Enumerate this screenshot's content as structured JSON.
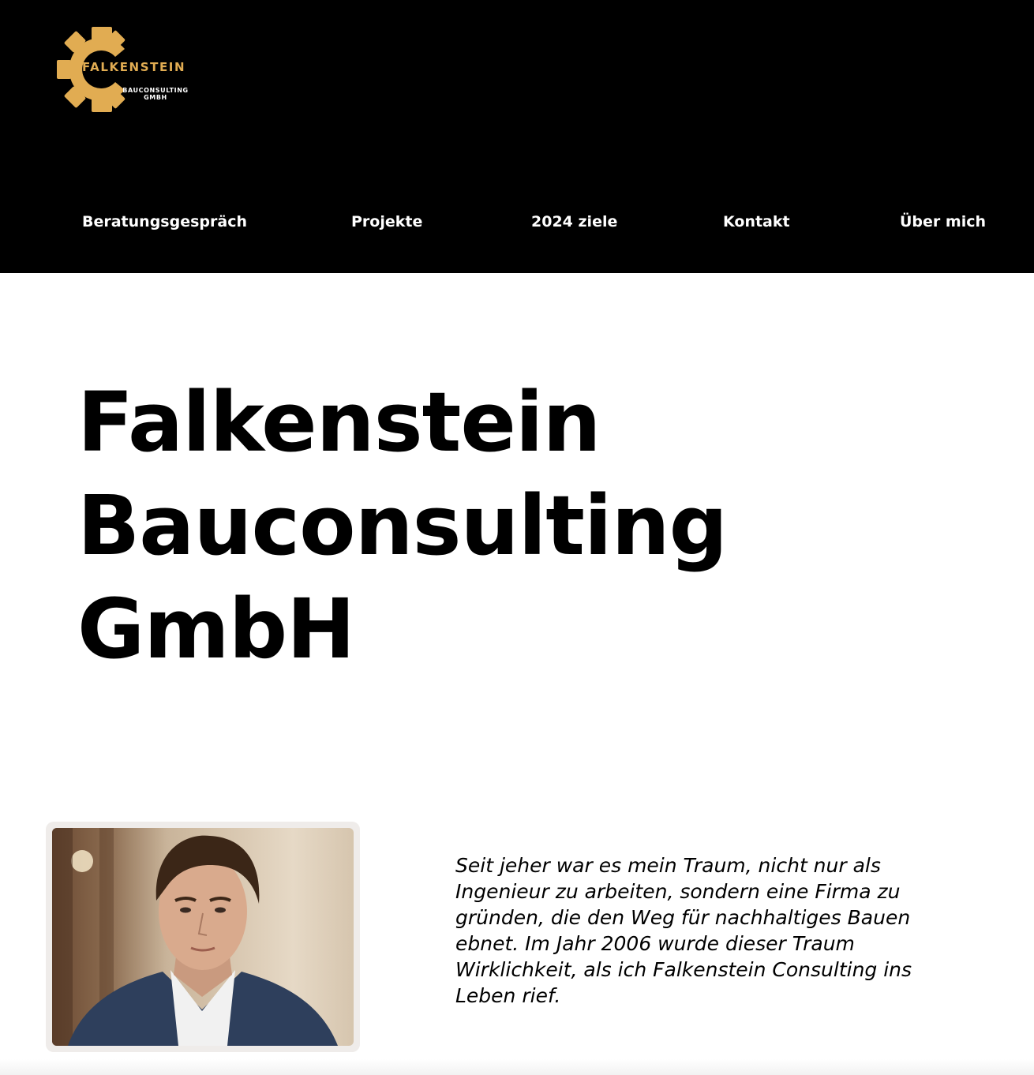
{
  "logo": {
    "word": "FALKENSTEIN",
    "subline1": "BAUCONSULTING",
    "subline2": "GMBH",
    "accent_color": "#e1ac52",
    "icon": "gear-icon"
  },
  "nav": {
    "items": [
      {
        "label": "Beratungsgespräch"
      },
      {
        "label": "Projekte"
      },
      {
        "label": "2024 ziele"
      },
      {
        "label": "Kontakt"
      },
      {
        "label": "Über mich"
      }
    ]
  },
  "hero": {
    "title_lines": [
      "Falkenstein",
      "Bauconsulting",
      "GmbH"
    ]
  },
  "about": {
    "photo_alt": "portrait-photo",
    "text": "Seit jeher war es mein Traum, nicht nur als Ingenieur zu arbeiten, sondern eine Firma zu gründen, die den Weg für nachhaltiges Bauen ebnet. Im Jahr 2006 wurde dieser Traum Wirklichkeit, als ich Falkenstein Consulting ins Leben rief."
  },
  "colors": {
    "header_bg": "#000000",
    "page_bg": "#ffffff",
    "text": "#000000"
  }
}
